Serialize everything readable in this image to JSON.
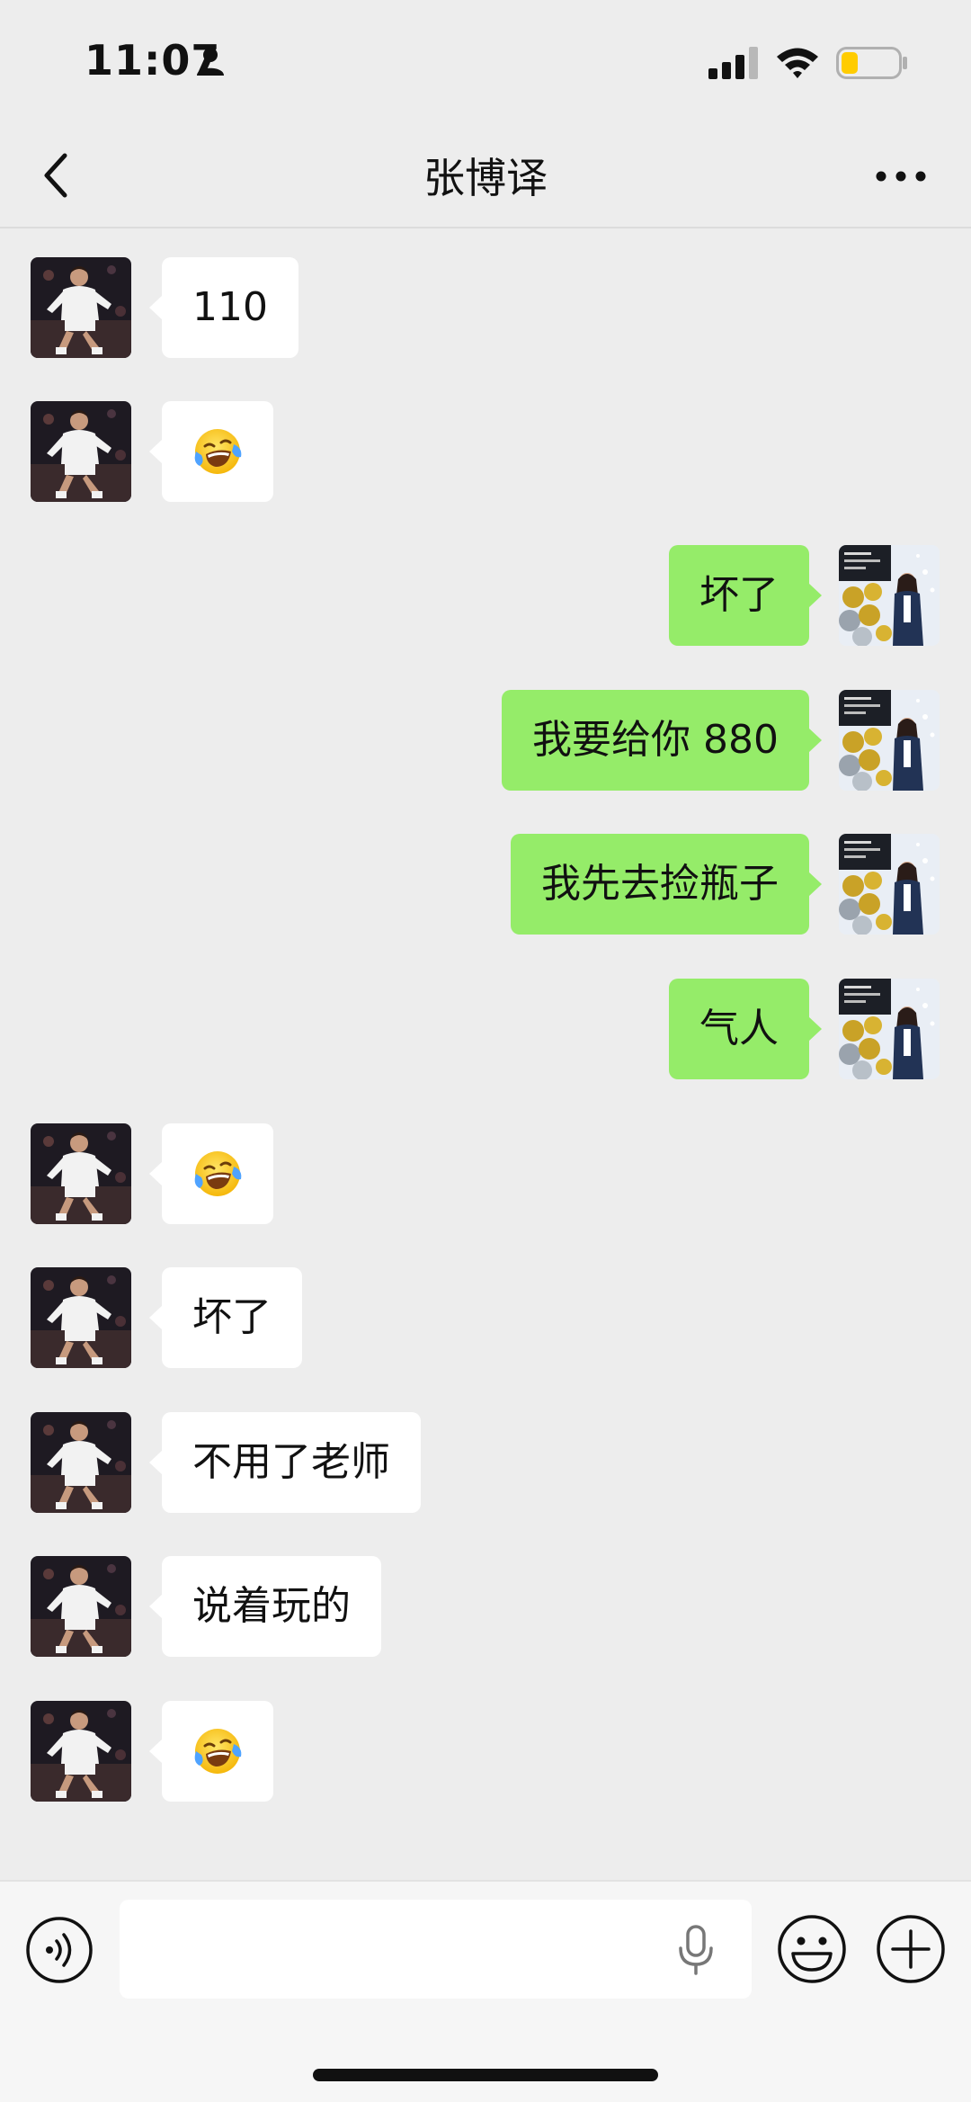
{
  "status_bar": {
    "time": "11:07"
  },
  "nav": {
    "title": "张博译"
  },
  "messages": [
    {
      "side": "in",
      "text": "110"
    },
    {
      "side": "in",
      "emoji": "crying-laughing-face"
    },
    {
      "side": "out",
      "text": "坏了"
    },
    {
      "side": "out",
      "text": "我要给你 880"
    },
    {
      "side": "out",
      "text": "我先去捡瓶子"
    },
    {
      "side": "out",
      "text": "气人"
    },
    {
      "side": "in",
      "emoji": "crying-laughing-face"
    },
    {
      "side": "in",
      "text": "坏了"
    },
    {
      "side": "in",
      "text": "不用了老师"
    },
    {
      "side": "in",
      "text": "说着玩的"
    },
    {
      "side": "in",
      "emoji": "crying-laughing-face"
    }
  ],
  "colors": {
    "background": "#ededed",
    "outgoing_bubble": "#95ec69",
    "incoming_bubble": "#ffffff",
    "battery_level": "#ffcc00"
  },
  "battery": {
    "level": 0.3
  },
  "icons": {
    "back": "back-arrow-icon",
    "more": "more-dots-icon",
    "voice": "voice-toggle-icon",
    "mic": "microphone-icon",
    "emoji": "emoji-face-icon",
    "plus": "plus-icon"
  }
}
